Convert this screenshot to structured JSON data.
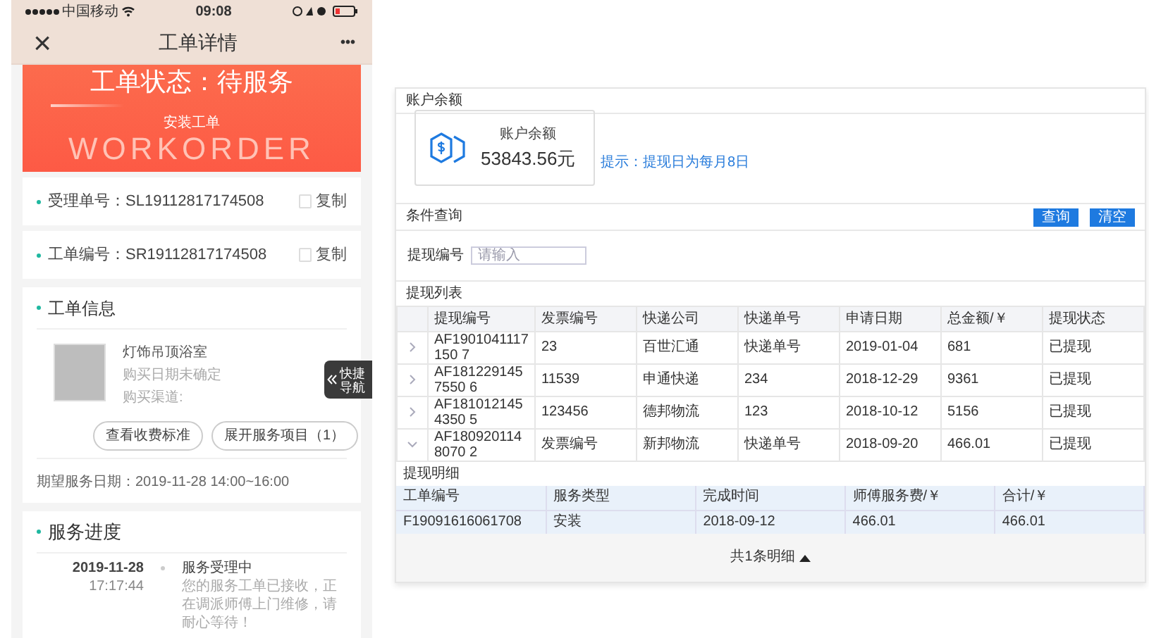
{
  "phone": {
    "status_bar": {
      "carrier": "中国移动",
      "time": "09:08"
    },
    "nav": {
      "title": "工单详情",
      "close": "×",
      "more": "•••"
    },
    "banner": {
      "status": "工单状态：待服务",
      "type": "安装工单",
      "watermark": "WORKORDER"
    },
    "id_rows": [
      {
        "label": "受理单号：SL19112817174508",
        "action": "复制"
      },
      {
        "label": "工单编号：SR19112817174508",
        "action": "复制"
      }
    ],
    "info": {
      "title": "工单信息",
      "product": "灯饰吊顶浴室",
      "purchase_date": "购买日期未确定",
      "channel": "购买渠道:",
      "buttons": [
        "查看收费标准",
        "展开服务项目（1）"
      ],
      "expected": "期望服务日期：2019-11-28 14:00~16:00"
    },
    "quick_nav": "快捷导航",
    "progress": {
      "title": "服务进度",
      "entries": [
        {
          "date": "2019-11-28",
          "time": "17:17:44",
          "title": "服务受理中",
          "text": "您的服务工单已接收，正在调派师傅上门维修，请耐心等待！"
        }
      ]
    }
  },
  "panel": {
    "balance_section": "账户余额",
    "balance": {
      "label": "账户余额",
      "amount": "53843.56元",
      "hint": "提示：提现日为每月8日"
    },
    "query": {
      "title": "条件查询",
      "buttons": [
        "查询",
        "清空"
      ],
      "field_label": "提现编号",
      "placeholder": "请输入"
    },
    "list": {
      "title": "提现列表",
      "columns": [
        "提现编号",
        "发票编号",
        "快递公司",
        "快递单号",
        "申请日期",
        "总金额/￥",
        "提现状态"
      ],
      "rows": [
        {
          "expanded": false,
          "cells": [
            "AF1901041117150 7",
            "23",
            "百世汇通",
            "快递单号",
            "2019-01-04",
            "681",
            "已提现"
          ]
        },
        {
          "expanded": false,
          "cells": [
            "AF1812291457550 6",
            "11539",
            "申通快递",
            "234",
            "2018-12-29",
            "9361",
            "已提现"
          ]
        },
        {
          "expanded": false,
          "cells": [
            "AF1810121454350 5",
            "123456",
            "德邦物流",
            "123",
            "2018-10-12",
            "5156",
            "已提现"
          ]
        },
        {
          "expanded": true,
          "cells": [
            "AF1809201148070 2",
            "发票编号",
            "新邦物流",
            "快递单号",
            "2018-09-20",
            "466.01",
            "已提现"
          ]
        }
      ]
    },
    "detail": {
      "title": "提现明细",
      "columns": [
        "工单编号",
        "服务类型",
        "完成时间",
        "师傅服务费/￥",
        "合计/￥"
      ],
      "rows": [
        [
          "F19091616061708",
          "安装",
          "2018-09-12",
          "466.01",
          "466.01"
        ]
      ],
      "footer": "共1条明细"
    }
  }
}
